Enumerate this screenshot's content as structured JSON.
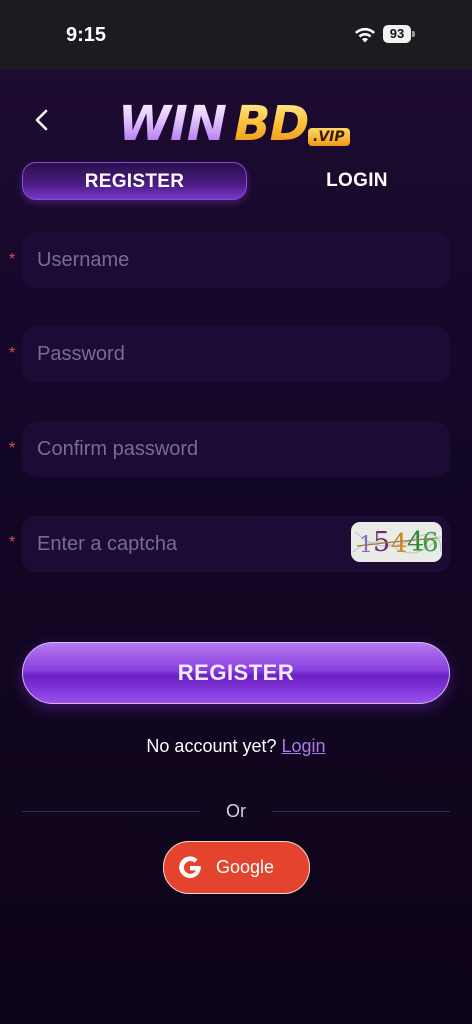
{
  "status_bar": {
    "time": "9:15",
    "battery": "93"
  },
  "header": {
    "logo_main": "WIN",
    "logo_accent": "BD",
    "logo_badge": ".VIP"
  },
  "tabs": [
    {
      "label": "REGISTER",
      "active": true
    },
    {
      "label": "LOGIN",
      "active": false
    }
  ],
  "form": {
    "required_marker": "*",
    "username_placeholder": "Username",
    "password_placeholder": "Password",
    "confirm_placeholder": "Confirm password",
    "captcha_placeholder": "Enter a captcha",
    "captcha_code": "15446"
  },
  "register_button": "REGISTER",
  "footer": {
    "no_account_text": "No account yet?",
    "login_link": "Login",
    "or_text": "Or",
    "google_label": "Google"
  },
  "colors": {
    "background": "#12061f",
    "accent_purple": "#8a3fe0",
    "field_bg": "#1c0b34",
    "required": "#e04a5a",
    "google_red": "#e4442e",
    "link": "#a97bf0"
  }
}
